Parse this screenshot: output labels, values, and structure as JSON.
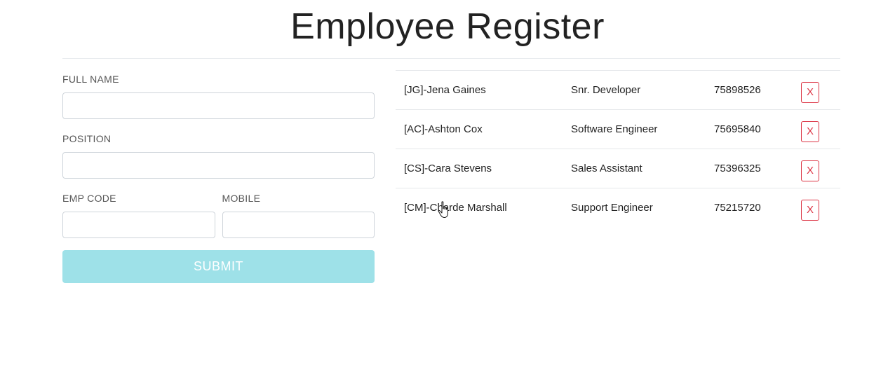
{
  "header": {
    "title": "Employee Register"
  },
  "form": {
    "full_name_label": "FULL NAME",
    "full_name_value": "",
    "position_label": "POSITION",
    "position_value": "",
    "emp_code_label": "EMP CODE",
    "emp_code_value": "",
    "mobile_label": "MOBILE",
    "mobile_value": "",
    "submit_label": "SUBMIT"
  },
  "employees": [
    {
      "name": "[JG]-Jena Gaines",
      "position": "Snr. Developer",
      "mobile": "75898526",
      "delete_label": "X"
    },
    {
      "name": "[AC]-Ashton Cox",
      "position": "Software Engineer",
      "mobile": "75695840",
      "delete_label": "X"
    },
    {
      "name": "[CS]-Cara Stevens",
      "position": "Sales Assistant",
      "mobile": "75396325",
      "delete_label": "X"
    },
    {
      "name": "[CM]-Charde Marshall",
      "position": "Support Engineer",
      "mobile": "75215720",
      "delete_label": "X"
    }
  ],
  "colors": {
    "submit_bg": "#9ee1e8",
    "delete_accent": "#dc3545"
  },
  "icons": {
    "cursor": "hand-pointer-icon"
  }
}
